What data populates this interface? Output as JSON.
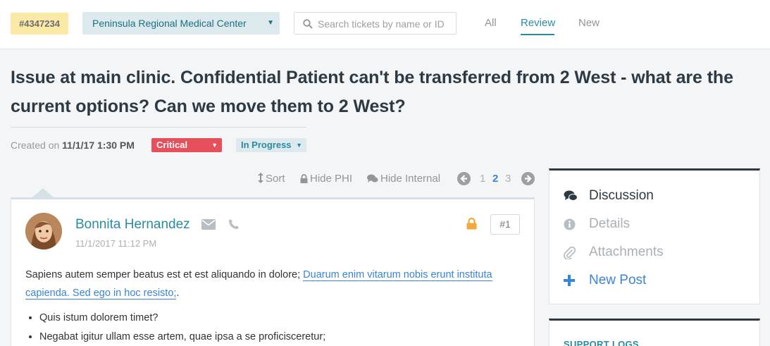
{
  "header": {
    "ticket_id": "#4347234",
    "facility": "Peninsula Regional Medical Center",
    "search_placeholder": "Search tickets by name or ID",
    "tabs": [
      {
        "label": "All",
        "active": false
      },
      {
        "label": "Review",
        "active": true
      },
      {
        "label": "New",
        "active": false
      }
    ]
  },
  "ticket": {
    "title": "Issue at main clinic. Confidential Patient can't be transferred from 2 West - what are the current options? Can we move them to 2 West?",
    "created_label": "Created on",
    "created_value": "11/1/17 1:30 PM",
    "priority": "Critical",
    "status": "In Progress"
  },
  "toolbar": {
    "sort": "Sort",
    "hide_phi": "Hide PHI",
    "hide_internal": "Hide Internal",
    "pages": [
      "1",
      "2",
      "3"
    ],
    "current_page": "2"
  },
  "post": {
    "author": "Bonnita Hernandez",
    "date": "11/1/2017 11:12 PM",
    "number": "#1",
    "text_plain": "Sapiens autem semper beatus est et est aliquando in dolore;",
    "text_link": "Duarum enim vitarum nobis erunt instituta capienda. Sed ego in hoc resisto;",
    "text_end": ".",
    "bullets": [
      "Quis istum dolorem timet?",
      "Negabat igitur ullam esse artem, quae ipsa a se proficisceretur;"
    ]
  },
  "sidebar": {
    "items": [
      {
        "label": "Discussion",
        "icon": "comments-icon",
        "active": true
      },
      {
        "label": "Details",
        "icon": "info-icon",
        "active": false
      },
      {
        "label": "Attachments",
        "icon": "paperclip-icon",
        "active": false
      },
      {
        "label": "New Post",
        "icon": "plus-icon",
        "active": false
      }
    ],
    "support_logs_title": "SUPPORT LOGS"
  },
  "colors": {
    "accent": "#2a8ba0",
    "critical": "#e5505a",
    "link": "#3b83d3",
    "ticket_badge": "#fbe9a6"
  }
}
